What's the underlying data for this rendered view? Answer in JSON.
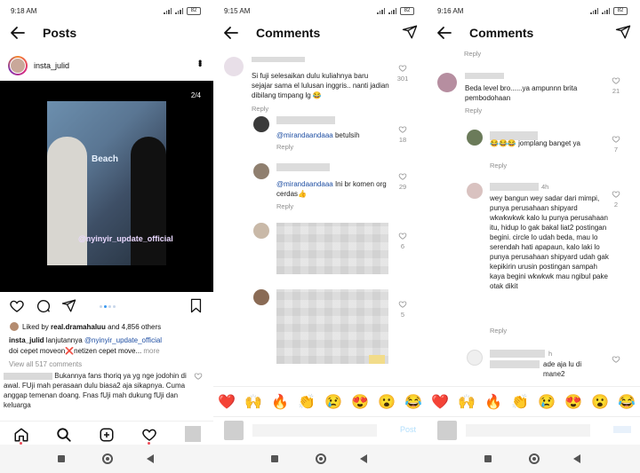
{
  "panel1": {
    "status_time": "9:18 AM",
    "battery": "82",
    "title": "Posts",
    "username": "insta_julid",
    "photo_counter": "2/4",
    "video_sign": "Beach",
    "watermark": "@nyinyir_update_official",
    "liked_by_prefix": "Liked by ",
    "liked_by_user": "real.dramahaluu",
    "liked_by_suffix": " and 4,856 others",
    "caption_user": "insta_julid",
    "caption_text1": " lanjutannya ",
    "caption_mention": "@nyinyir_update_official",
    "caption_line2a": "doi cepet moveon",
    "caption_cross": "❌",
    "caption_line2b": "netizen cepet move...",
    "caption_more": " more",
    "view_all": "View all 517 comments",
    "inline_comment_tail": "Bukannya fans thoriq ya yg nge jodohin di awal. FUji mah perasaan dulu biasa2 aja sikapnya. Cuma anggap temenan doang. Fnas fUji mah dukung fUji dan keluarga"
  },
  "panel2": {
    "status_time": "9:15 AM",
    "battery": "82",
    "title": "Comments",
    "comments": [
      {
        "text": "Si fuji selesaikan dulu kuliahnya baru sejajar sama el lulusan inggris.. nanti jadian dibilang timpang lg 😂",
        "reply": "Reply",
        "likes": "301"
      },
      {
        "mention": "@mirandaandaaa",
        "text": " betulsih",
        "reply": "Reply",
        "likes": "18"
      },
      {
        "mention": "@mirandaandaaa",
        "text": " Ini br komen org cerdas👍",
        "reply": "Reply",
        "likes": "29"
      },
      {
        "likes": "6"
      },
      {
        "likes": "5"
      }
    ],
    "post_label": "Post"
  },
  "panel3": {
    "status_time": "9:16 AM",
    "battery": "82",
    "title": "Comments",
    "top_reply": "Reply",
    "comments": [
      {
        "text": "Beda level bro......ya ampunnn brita pembodohaan",
        "reply": "Reply",
        "likes": "21"
      },
      {
        "text": "😂😂😂 jomplang banget ya",
        "reply": "Reply",
        "likes": "7"
      },
      {
        "time": "4h",
        "text": "wey bangun wey sadar dari mimpi, punya perusahaan shipyard wkwkwkwk kalo lu punya perusahaan itu, hidup lo gak bakal liat2 postingan begini. circle lo udah beda, mau lo serendah hati apapaun, kalo laki lo punya perusahaan shipyard udah gak kepikirin urusin postingan sampah kaya begini wkwkwk mau ngibul pake otak dikit",
        "reply": "Reply",
        "likes": "2"
      },
      {
        "time": "h",
        "text": "ade aja lu di mane2"
      }
    ]
  },
  "emojis": [
    "❤️",
    "🙌",
    "🔥",
    "👏",
    "😢",
    "😍",
    "😮",
    "😂"
  ]
}
